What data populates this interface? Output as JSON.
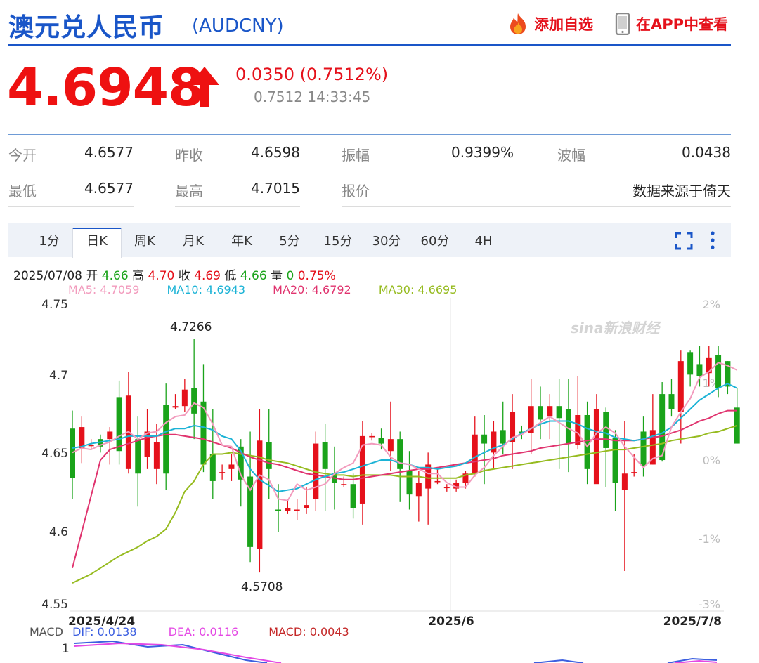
{
  "header": {
    "title": "澳元兑人民币",
    "code": "(AUDCNY)",
    "add_favorite": "添加自选",
    "view_in_app": "在APP中查看"
  },
  "quote": {
    "price": "4.6948",
    "change": "0.0350 (0.7512%)",
    "sub": "0.7512 14:33:45",
    "direction": "up"
  },
  "stats": [
    {
      "label": "今开",
      "value": "4.6577"
    },
    {
      "label": "昨收",
      "value": "4.6598"
    },
    {
      "label": "振幅",
      "value": "0.9399%"
    },
    {
      "label": "波幅",
      "value": "0.0438"
    },
    {
      "label": "最低",
      "value": "4.6577"
    },
    {
      "label": "最高",
      "value": "4.7015"
    },
    {
      "label": "报价",
      "value": ""
    },
    {
      "label": "",
      "value": "数据来源于倚天"
    }
  ],
  "tabs": [
    "1分",
    "日K",
    "周K",
    "月K",
    "年K",
    "5分",
    "15分",
    "30分",
    "60分",
    "4H"
  ],
  "active_tab": "日K",
  "ohlc": {
    "date": "2025/07/08",
    "open_label": "开",
    "open": "4.66",
    "high_label": "高",
    "high": "4.70",
    "close_label": "收",
    "close": "4.69",
    "low_label": "低",
    "low": "4.66",
    "volume_label": "量",
    "volume": "0",
    "pct": "0.75%"
  },
  "ma_legend": {
    "ma5": "MA5: 4.7059",
    "ma10": "MA10: 4.6943",
    "ma20": "MA20: 4.6792",
    "ma30": "MA30: 4.6695"
  },
  "macd_legend": {
    "label": "MACD",
    "dif": "DIF: 0.0138",
    "dea": "DEA: 0.0116",
    "macd": "MACD: 0.0043"
  },
  "colors": {
    "brand_blue": "#1a56c8",
    "up_red": "#e5111b",
    "down_green": "#1aa31a",
    "ma5": "#f29bbd",
    "ma10": "#1cb3d6",
    "ma20": "#e0336e",
    "ma30": "#96bb1f",
    "dif": "#3c5fe0",
    "dea": "#e449e4"
  },
  "icons": {
    "add_favorite": "flame-icon",
    "view_in_app": "phone-icon",
    "fullscreen": "fullscreen-icon",
    "more": "more-icon",
    "price_direction": "arrow-up-icon"
  },
  "chart_data": {
    "type": "candlestick",
    "y_ticks": [
      "4.75",
      "4.7",
      "4.65",
      "4.6",
      "4.55"
    ],
    "y_right_ticks": [
      "2%",
      "1%",
      "0%",
      "-1%",
      "-3%"
    ],
    "x_labels": [
      "2025/4/24",
      "2025/6",
      "2025/7/8"
    ],
    "ylim": [
      4.55,
      4.75
    ],
    "annotations": [
      {
        "text": "4.7266",
        "value": 4.7266
      },
      {
        "text": "4.5708",
        "value": 4.5708
      }
    ],
    "watermark": "sina新浪财经",
    "candles": [
      [
        4.667,
        4.634,
        4.679,
        4.62
      ],
      [
        4.654,
        4.668,
        4.675,
        4.644
      ],
      [
        4.656,
        4.656,
        4.66,
        4.653
      ],
      [
        4.66,
        4.655,
        4.663,
        4.651
      ],
      [
        4.66,
        4.665,
        4.668,
        4.643
      ],
      [
        4.688,
        4.652,
        4.699,
        4.643
      ],
      [
        4.64,
        4.689,
        4.705,
        4.637
      ],
      [
        4.66,
        4.637,
        4.675,
        4.615
      ],
      [
        4.648,
        4.665,
        4.68,
        4.64
      ],
      [
        4.64,
        4.658,
        4.67,
        4.63
      ],
      [
        4.683,
        4.637,
        4.697,
        4.626
      ],
      [
        4.681,
        4.682,
        4.69,
        4.68
      ],
      [
        4.682,
        4.693,
        4.7,
        4.678
      ],
      [
        4.694,
        4.677,
        4.727,
        4.66
      ],
      [
        4.685,
        4.643,
        4.71,
        4.638
      ],
      [
        4.65,
        4.632,
        4.68,
        4.62
      ],
      [
        4.638,
        4.638,
        4.643,
        4.633
      ],
      [
        4.64,
        4.643,
        4.65,
        4.632
      ],
      [
        4.655,
        4.633,
        4.66,
        4.615
      ],
      [
        4.635,
        4.588,
        4.665,
        4.578
      ],
      [
        4.587,
        4.659,
        4.68,
        4.571
      ],
      [
        4.658,
        4.64,
        4.68,
        4.62
      ],
      [
        4.613,
        4.612,
        4.63,
        4.598
      ],
      [
        4.612,
        4.614,
        4.62,
        4.61
      ],
      [
        4.612,
        4.613,
        4.62,
        4.606
      ],
      [
        4.614,
        4.616,
        4.628,
        4.61
      ],
      [
        4.62,
        4.657,
        4.665,
        4.612
      ],
      [
        4.658,
        4.64,
        4.67,
        4.612
      ],
      [
        4.637,
        4.631,
        4.655,
        4.613
      ],
      [
        4.63,
        4.63,
        4.635,
        4.628
      ],
      [
        4.63,
        4.614,
        4.637,
        4.607
      ],
      [
        4.617,
        4.662,
        4.672,
        4.603
      ],
      [
        4.662,
        4.662,
        4.664,
        4.659
      ],
      [
        4.661,
        4.657,
        4.667,
        4.653
      ],
      [
        4.652,
        4.66,
        4.685,
        4.639
      ],
      [
        4.66,
        4.64,
        4.665,
        4.618
      ],
      [
        4.639,
        4.623,
        4.652,
        4.613
      ],
      [
        4.622,
        4.631,
        4.639,
        4.605
      ],
      [
        4.627,
        4.643,
        4.651,
        4.603
      ],
      [
        4.632,
        4.632,
        4.64,
        4.63
      ],
      [
        4.628,
        4.628,
        4.63,
        4.625
      ],
      [
        4.627,
        4.631,
        4.633,
        4.625
      ],
      [
        4.631,
        4.637,
        4.639,
        4.627
      ],
      [
        4.637,
        4.663,
        4.675,
        4.635
      ],
      [
        4.663,
        4.657,
        4.676,
        4.63
      ],
      [
        4.651,
        4.665,
        4.672,
        4.64
      ],
      [
        4.666,
        4.657,
        4.685,
        4.65
      ],
      [
        4.658,
        4.678,
        4.69,
        4.64
      ],
      [
        4.665,
        4.664,
        4.669,
        4.66
      ],
      [
        4.664,
        4.682,
        4.7,
        4.65
      ],
      [
        4.682,
        4.673,
        4.695,
        4.66
      ],
      [
        4.675,
        4.682,
        4.69,
        4.66
      ],
      [
        4.682,
        4.674,
        4.7,
        4.64
      ],
      [
        4.68,
        4.657,
        4.7,
        4.638
      ],
      [
        4.656,
        4.676,
        4.702,
        4.653
      ],
      [
        4.676,
        4.64,
        4.685,
        4.63
      ],
      [
        4.63,
        4.68,
        4.69,
        4.64
      ],
      [
        4.678,
        4.654,
        4.681,
        4.628
      ],
      [
        4.661,
        4.631,
        4.666,
        4.612
      ],
      [
        4.626,
        4.637,
        4.672,
        4.572
      ],
      [
        4.638,
        4.638,
        4.65,
        4.635
      ],
      [
        4.665,
        4.642,
        4.675,
        4.635
      ],
      [
        4.643,
        4.666,
        4.69,
        4.643
      ],
      [
        4.69,
        4.646,
        4.698,
        4.645
      ],
      [
        4.69,
        4.68,
        4.7,
        4.675
      ],
      [
        4.678,
        4.712,
        4.719,
        4.657
      ],
      [
        4.718,
        4.703,
        4.719,
        4.695
      ],
      [
        4.71,
        4.702,
        4.722,
        4.695
      ],
      [
        4.704,
        4.714,
        4.722,
        4.695
      ],
      [
        4.716,
        4.694,
        4.722,
        4.688
      ],
      [
        4.712,
        4.695,
        4.712,
        4.69
      ],
      [
        4.681,
        4.657,
        4.694,
        4.657
      ]
    ],
    "ma5": [
      4.651,
      4.654,
      4.653,
      4.656,
      4.658,
      4.662,
      4.665,
      4.66,
      4.664,
      4.665,
      4.671,
      4.675,
      4.676,
      4.684,
      4.681,
      4.67,
      4.656,
      4.655,
      4.636,
      4.626,
      4.636,
      4.633,
      4.62,
      4.619,
      4.63,
      4.626,
      4.628,
      4.63,
      4.637,
      4.641,
      4.644,
      4.656,
      4.657,
      4.656,
      4.648,
      4.644,
      4.643,
      4.64,
      4.637,
      4.637,
      4.631,
      4.628,
      4.628,
      4.636,
      4.641,
      4.649,
      4.655,
      4.661,
      4.663,
      4.667,
      4.671,
      4.675,
      4.671,
      4.667,
      4.664,
      4.655,
      4.664,
      4.668,
      4.664,
      4.655,
      4.648,
      4.641,
      4.647,
      4.649,
      4.668,
      4.678,
      4.687,
      4.701,
      4.705,
      4.711,
      4.709,
      4.706
    ],
    "ma10": [
      4.654,
      4.655,
      4.657,
      4.658,
      4.659,
      4.66,
      4.662,
      4.662,
      4.662,
      4.662,
      4.665,
      4.667,
      4.667,
      4.669,
      4.668,
      4.666,
      4.662,
      4.66,
      4.652,
      4.64,
      4.633,
      4.629,
      4.625,
      4.626,
      4.627,
      4.63,
      4.633,
      4.635,
      4.637,
      4.638,
      4.64,
      4.642,
      4.644,
      4.646,
      4.646,
      4.644,
      4.643,
      4.641,
      4.641,
      4.64,
      4.641,
      4.642,
      4.644,
      4.648,
      4.651,
      4.654,
      4.656,
      4.66,
      4.664,
      4.667,
      4.67,
      4.672,
      4.672,
      4.672,
      4.67,
      4.667,
      4.665,
      4.664,
      4.661,
      4.66,
      4.659,
      4.66,
      4.662,
      4.664,
      4.668,
      4.674,
      4.68,
      4.686,
      4.69,
      4.694,
      4.697,
      4.694
    ],
    "ma20": [
      4.574,
      4.598,
      4.622,
      4.646,
      4.653,
      4.655,
      4.657,
      4.659,
      4.661,
      4.662,
      4.663,
      4.663,
      4.662,
      4.661,
      4.66,
      4.658,
      4.656,
      4.654,
      4.651,
      4.648,
      4.646,
      4.644,
      4.643,
      4.641,
      4.639,
      4.637,
      4.636,
      4.635,
      4.634,
      4.633,
      4.633,
      4.634,
      4.635,
      4.636,
      4.637,
      4.638,
      4.639,
      4.64,
      4.64,
      4.641,
      4.642,
      4.643,
      4.644,
      4.645,
      4.646,
      4.647,
      4.649,
      4.65,
      4.651,
      4.652,
      4.654,
      4.655,
      4.656,
      4.657,
      4.658,
      4.659,
      4.66,
      4.66,
      4.659,
      4.659,
      4.659,
      4.66,
      4.661,
      4.662,
      4.664,
      4.666,
      4.669,
      4.672,
      4.674,
      4.677,
      4.679,
      4.679
    ],
    "ma30": [
      4.564,
      4.567,
      4.57,
      4.574,
      4.578,
      4.582,
      4.585,
      4.588,
      4.592,
      4.595,
      4.6,
      4.611,
      4.625,
      4.632,
      4.643,
      4.65,
      4.65,
      4.651,
      4.65,
      4.649,
      4.648,
      4.646,
      4.645,
      4.644,
      4.642,
      4.64,
      4.638,
      4.637,
      4.636,
      4.636,
      4.635,
      4.636,
      4.636,
      4.636,
      4.636,
      4.635,
      4.635,
      4.635,
      4.634,
      4.634,
      4.634,
      4.634,
      4.636,
      4.637,
      4.639,
      4.64,
      4.641,
      4.642,
      4.643,
      4.644,
      4.645,
      4.646,
      4.647,
      4.648,
      4.649,
      4.65,
      4.651,
      4.652,
      4.653,
      4.653,
      4.654,
      4.655,
      4.656,
      4.657,
      4.659,
      4.66,
      4.661,
      4.662,
      4.664,
      4.665,
      4.667,
      4.669
    ]
  }
}
